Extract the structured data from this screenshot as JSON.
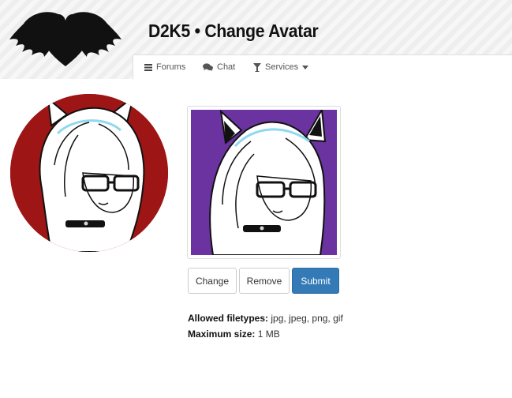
{
  "header": {
    "title": "D2K5 • Change Avatar",
    "logo_icon": "winged-heart-icon"
  },
  "nav": {
    "items": [
      {
        "label": "Forums",
        "icon": "bars-icon"
      },
      {
        "label": "Chat",
        "icon": "comments-icon"
      },
      {
        "label": "Services",
        "icon": "glass-icon",
        "dropdown": true
      }
    ]
  },
  "avatar": {
    "circle_background": "#9e1515",
    "preview_background": "#6a33a0"
  },
  "buttons": {
    "change": "Change",
    "remove": "Remove",
    "submit": "Submit"
  },
  "info": {
    "filetypes_label": "Allowed filetypes:",
    "filetypes_value": "jpg, jpeg, png, gif",
    "maxsize_label": "Maximum size:",
    "maxsize_value": "1 MB"
  },
  "colors": {
    "primary": "#337ab7",
    "text": "#333333"
  }
}
